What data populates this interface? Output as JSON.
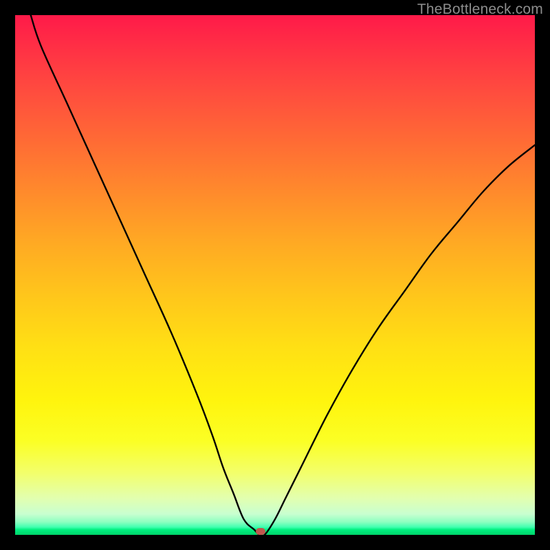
{
  "watermark": "TheBottleneck.com",
  "marker": {
    "x_pct": 47.2,
    "y_pct": 99.4
  },
  "chart_data": {
    "type": "line",
    "title": "",
    "xlabel": "",
    "ylabel": "",
    "xlim": [
      0,
      100
    ],
    "ylim": [
      0,
      100
    ],
    "grid": false,
    "legend": false,
    "background": "rainbow-gradient (red→yellow→green, top→bottom)",
    "series": [
      {
        "name": "bottleneck-curve",
        "x": [
          3,
          5,
          10,
          15,
          20,
          25,
          30,
          35,
          38,
          40,
          42,
          44,
          46,
          47,
          48,
          50,
          52,
          55,
          60,
          65,
          70,
          75,
          80,
          85,
          90,
          95,
          100
        ],
        "y": [
          100,
          94,
          83,
          72,
          61,
          50,
          39,
          27,
          19,
          13,
          8,
          3,
          1,
          0,
          0,
          3,
          7,
          13,
          23,
          32,
          40,
          47,
          54,
          60,
          66,
          71,
          75
        ]
      }
    ],
    "marker": {
      "x": 47.2,
      "y": 0.6
    },
    "note": "Values read by eye from a chart with no numeric axes; y = distance from bottom edge as percent of plot height."
  }
}
